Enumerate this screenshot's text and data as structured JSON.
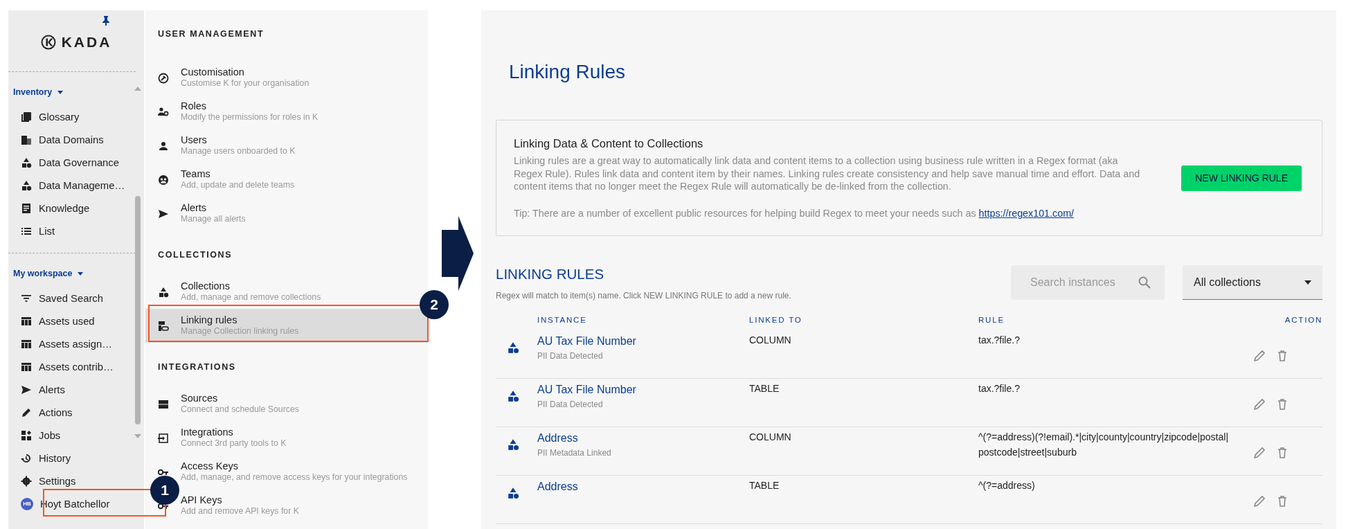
{
  "sidebar": {
    "logo": "KADA",
    "sections": [
      {
        "title": "Inventory",
        "items": [
          {
            "label": "Glossary"
          },
          {
            "label": "Data Domains"
          },
          {
            "label": "Data Governance"
          },
          {
            "label": "Data Manageme…"
          },
          {
            "label": "Knowledge"
          },
          {
            "label": "List"
          }
        ]
      },
      {
        "title": "My workspace",
        "items": [
          {
            "label": "Saved Search"
          },
          {
            "label": "Assets used"
          },
          {
            "label": "Assets assign…"
          },
          {
            "label": "Assets contrib…"
          },
          {
            "label": "Alerts"
          },
          {
            "label": "Actions"
          },
          {
            "label": "Jobs"
          },
          {
            "label": "History"
          },
          {
            "label": "Settings"
          }
        ]
      }
    ],
    "user": {
      "initials": "HB",
      "name": "Hoyt Batchellor"
    }
  },
  "menu": [
    {
      "title": "USER MANAGEMENT",
      "items": [
        {
          "title": "Customisation",
          "subtitle": "Customise K for your organisation",
          "selected": false
        },
        {
          "title": "Roles",
          "subtitle": "Modify the permissions for roles in K",
          "selected": false
        },
        {
          "title": "Users",
          "subtitle": "Manage users onboarded to K",
          "selected": false
        },
        {
          "title": "Teams",
          "subtitle": "Add, update and delete teams",
          "selected": false
        },
        {
          "title": "Alerts",
          "subtitle": "Manage all alerts",
          "selected": false
        }
      ]
    },
    {
      "title": "COLLECTIONS",
      "items": [
        {
          "title": "Collections",
          "subtitle": "Add, manage and remove collections",
          "selected": false
        },
        {
          "title": "Linking rules",
          "subtitle": "Manage Collection linking rules",
          "selected": true
        }
      ]
    },
    {
      "title": "INTEGRATIONS",
      "items": [
        {
          "title": "Sources",
          "subtitle": "Connect and schedule Sources",
          "selected": false
        },
        {
          "title": "Integrations",
          "subtitle": "Connect 3rd party tools to K",
          "selected": false
        },
        {
          "title": "Access Keys",
          "subtitle": "Add, manage, and remove access keys for your integrations",
          "selected": false
        },
        {
          "title": "API Keys",
          "subtitle": "Add and remove API keys for K",
          "selected": false
        }
      ]
    }
  ],
  "callouts": [
    {
      "number": "1"
    },
    {
      "number": "2"
    }
  ],
  "page": {
    "title": "Linking Rules",
    "info": {
      "title": "Linking Data & Content to Collections",
      "body": "Linking rules are a great way to automatically link data and content items to a collection using business rule written in a Regex format (aka Regex Rule). Rules link data and content item by their names. Linking rules create consistency and help save manual time and effort. Data and content items that no longer meet the Regex Rule will automatically be de-linked from the collection.",
      "tip": "Tip: There are a number of excellent public resources for helping build Regex to meet your needs such as ",
      "link": "https://regex101.com/",
      "button": "NEW LINKING RULE"
    },
    "section": {
      "title": "LINKING RULES",
      "subtitle": "Regex will match to item(s) name. Click NEW LINKING RULE to add a new rule.",
      "search_placeholder": "Search instances",
      "filter": "All collections"
    },
    "table": {
      "columns": [
        "INSTANCE",
        "LINKED TO",
        "RULE",
        "ACTION"
      ],
      "rows": [
        {
          "name": "AU Tax File Number",
          "subtitle": "PII Data Detected",
          "linked_to": "COLUMN",
          "rule": "tax.?file.?"
        },
        {
          "name": "AU Tax File Number",
          "subtitle": "PII Data Detected",
          "linked_to": "TABLE",
          "rule": "tax.?file.?"
        },
        {
          "name": "Address",
          "subtitle": "PII Metadata Linked",
          "linked_to": "COLUMN",
          "rule": "^(?=address)(?!email).*|city|county|country|zipcode|postal|postcode|street|suburb"
        },
        {
          "name": "Address",
          "linked_to": "TABLE",
          "rule": "^(?=address)"
        }
      ]
    }
  }
}
